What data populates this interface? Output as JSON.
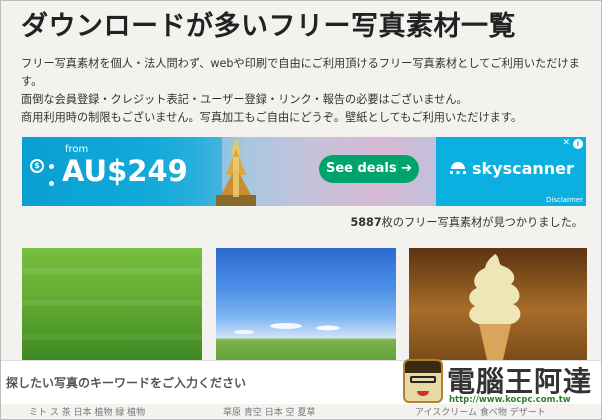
{
  "page": {
    "title": "ダウンロードが多いフリー写真素材一覧",
    "intro": [
      "フリー写真素材を個人・法人問わず、webや印刷で自由にご利用頂けるフリー写真素材としてご利用いただけます。",
      "面倒な会員登録・クレジット表記・ユーザー登録・リンク・報告の必要はございません。",
      "商用利用時の制限もございません。写真加工もご自由にどうぞ。壁紙としてもご利用いただけます。"
    ]
  },
  "ad": {
    "from": "from",
    "price": "AU$249",
    "cta": "See deals",
    "cta_arrow": "➔",
    "brand": "skyscanner",
    "disclaimer": "Disclaimer",
    "choice_label": "i",
    "close_label": "✕",
    "colors": {
      "cta": "#00a36b",
      "brand_bg": "#0bb0e0"
    }
  },
  "results": {
    "count": "5887",
    "suffix": "枚のフリー写真素材が見つかりました。"
  },
  "thumbnails": [
    {
      "subject": "grass field"
    },
    {
      "subject": "blue sky and field"
    },
    {
      "subject": "soft serve ice cream"
    }
  ],
  "search": {
    "placeholder": "探したい写真のキーワードをご入力ください"
  },
  "watermark": {
    "name": "電腦王阿達",
    "url": "http://www.kocpc.com.tw"
  },
  "tags": {
    "col1": "ミト ス 茶 日本 植物 緑 植物",
    "col2": "草原 青空 日本 空 夏草",
    "col3": "アイスクリーム 食べ物 デザート"
  }
}
